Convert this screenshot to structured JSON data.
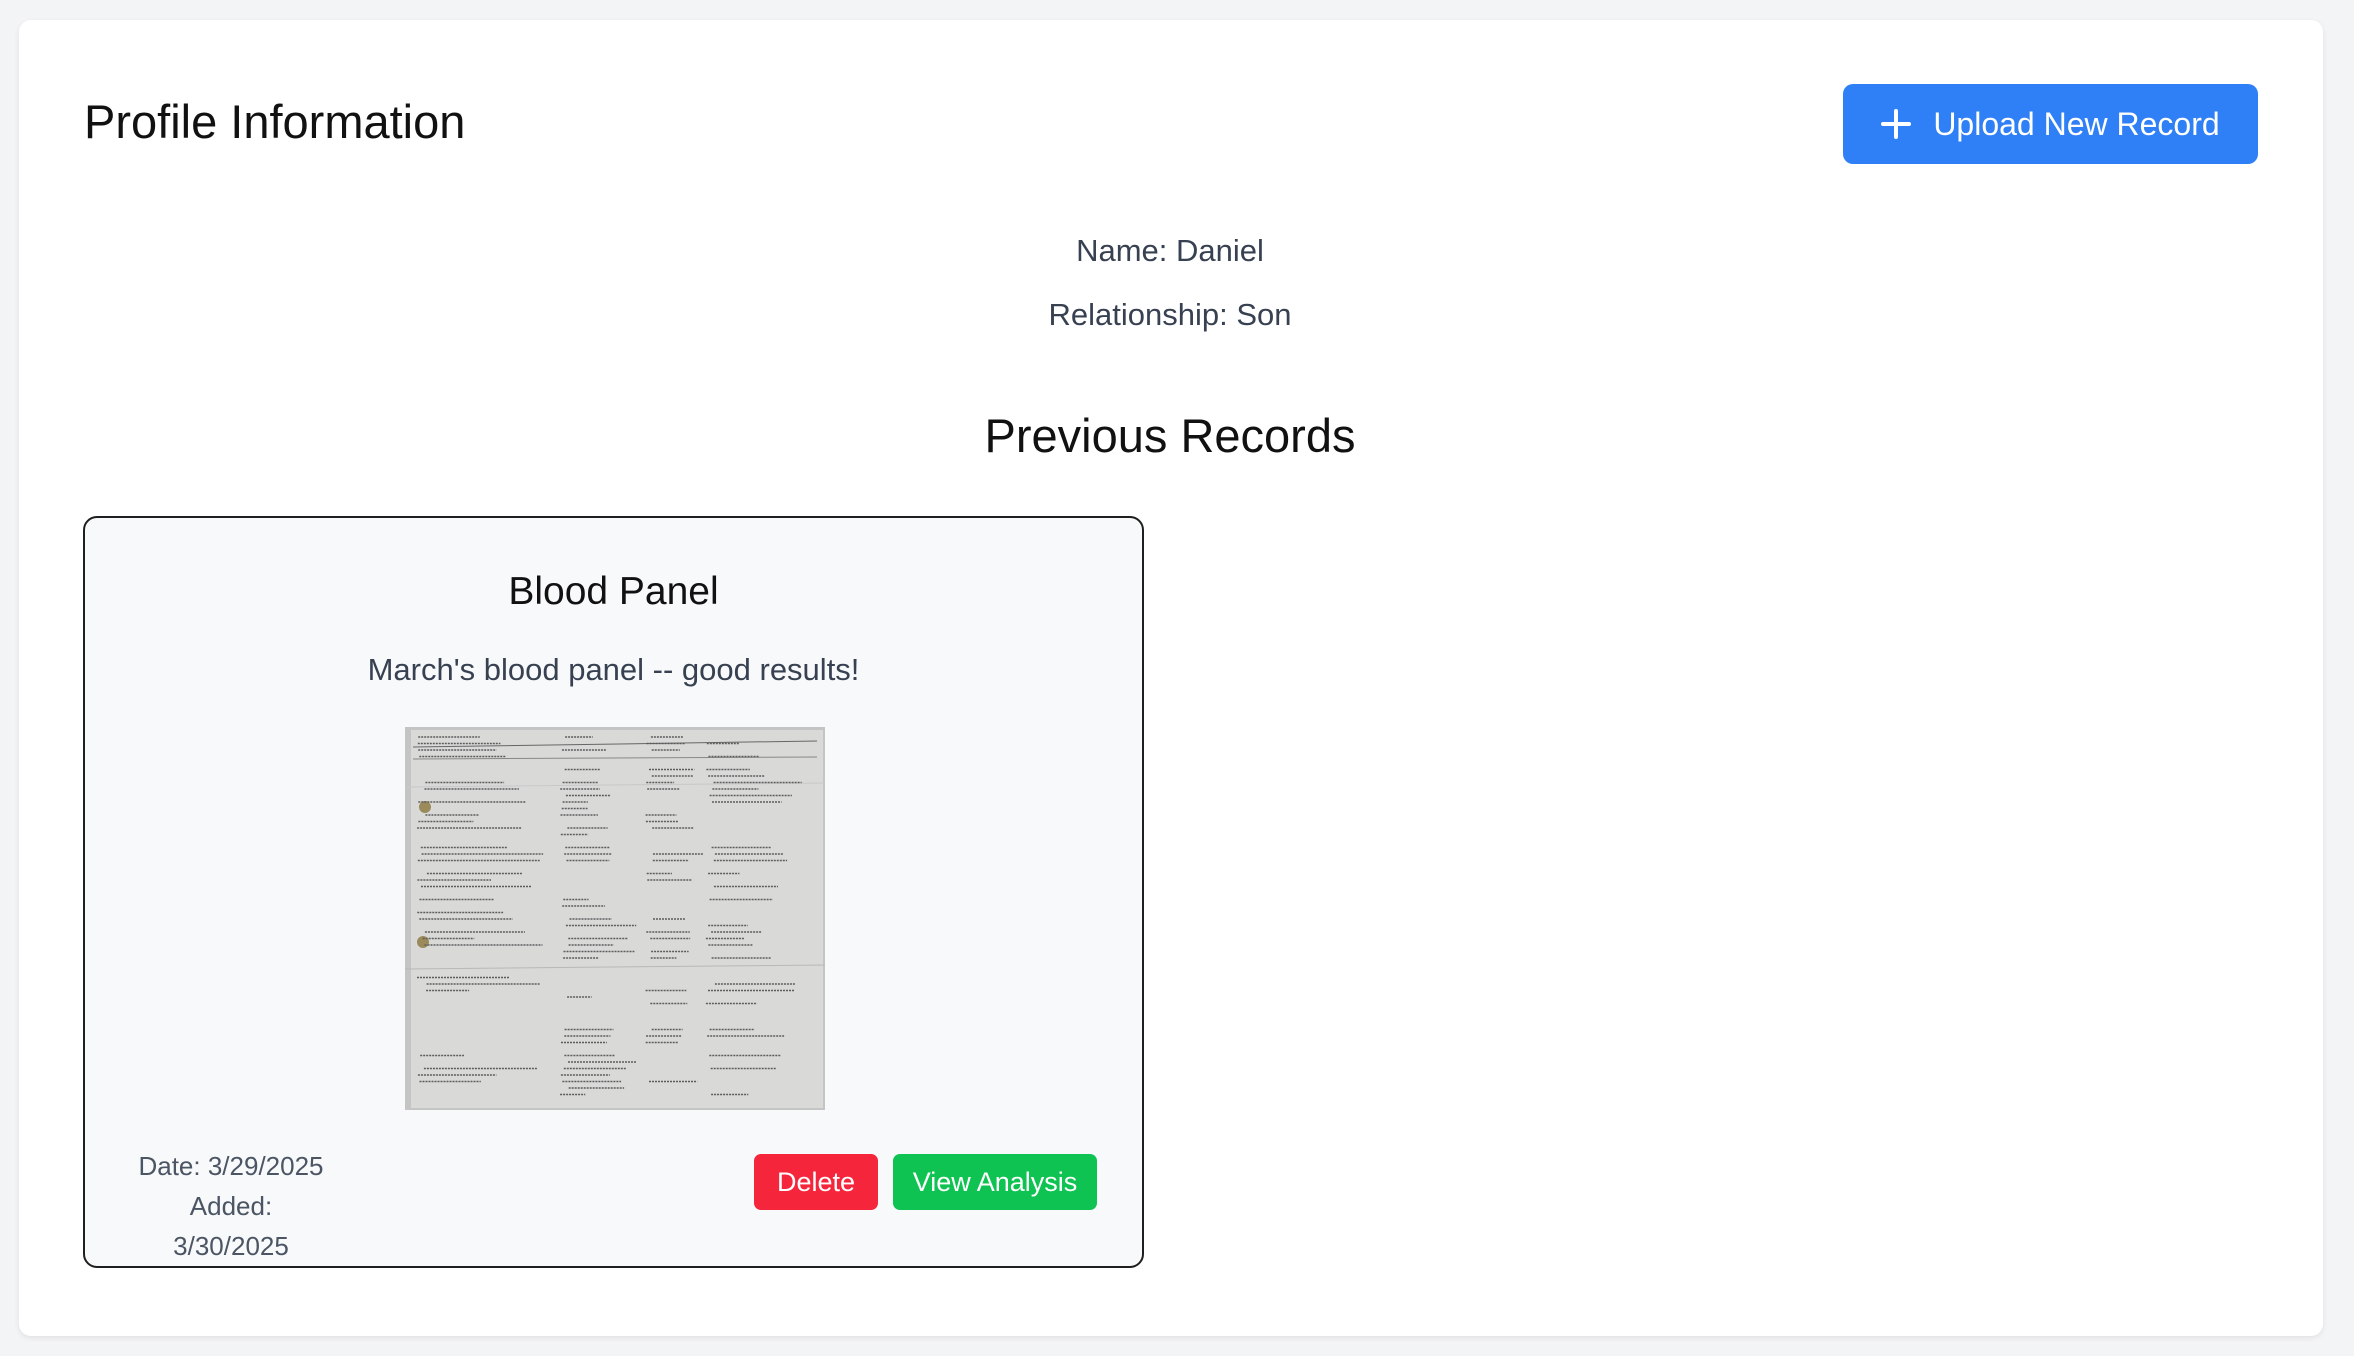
{
  "header": {
    "title": "Profile Information",
    "upload_label": "Upload New Record"
  },
  "profile": {
    "name_text": "Name: Daniel",
    "relationship_text": "Relationship: Son"
  },
  "records_section": {
    "title": "Previous Records",
    "records": [
      {
        "title": "Blood Panel",
        "description": "March's blood panel -- good results!",
        "date_text": "Date: 3/29/2025",
        "added_text": "Added: 3/30/2025",
        "delete_label": "Delete",
        "view_label": "View Analysis"
      }
    ]
  },
  "icons": {
    "upload": "plus-icon"
  },
  "colors": {
    "primary": "#2f80f6",
    "danger": "#f5263b",
    "success": "#0fc352",
    "background": "#f3f4f6",
    "card_background": "#f8f9fb"
  }
}
